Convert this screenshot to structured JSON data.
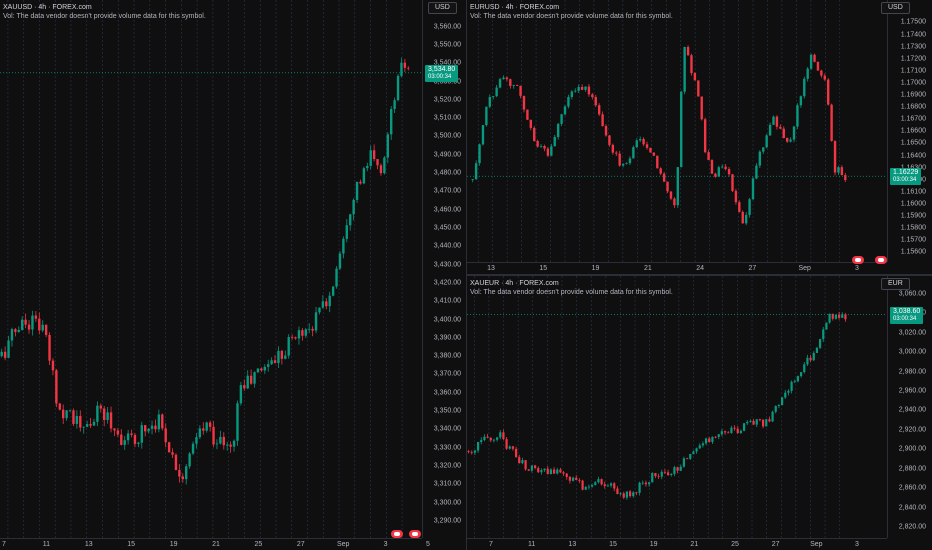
{
  "colors": {
    "up": "#089981",
    "down": "#f23645",
    "grid": "#2a2e39",
    "bg": "#0f0f0f",
    "text": "#b2b5be"
  },
  "panes": [
    {
      "id": "xauusd",
      "legend_symbol": "XAUUSD · 4h · FOREX.com",
      "legend_volume": "Vol: The data vendor doesn't provide volume data for this symbol.",
      "currency": "USD",
      "price_label": "3,534.80",
      "countdown": "03:00:34",
      "y_ticks": [
        "3,560.00",
        "3,550.00",
        "3,540.00",
        "3,530.00",
        "3,520.00",
        "3,510.00",
        "3,500.00",
        "3,490.00",
        "3,480.00",
        "3,470.00",
        "3,460.00",
        "3,450.00",
        "3,440.00",
        "3,430.00",
        "3,420.00",
        "3,410.00",
        "3,400.00",
        "3,390.00",
        "3,380.00",
        "3,370.00",
        "3,360.00",
        "3,350.00",
        "3,340.00",
        "3,330.00",
        "3,320.00",
        "3,310.00",
        "3,300.00",
        "3,290.00"
      ],
      "x_ticks": [
        "7",
        "11",
        "13",
        "15",
        "19",
        "21",
        "25",
        "27",
        "Sep",
        "3",
        "5"
      ]
    },
    {
      "id": "eurusd",
      "legend_symbol": "EURUSD · 4h · FOREX.com",
      "legend_volume": "Vol: The data vendor doesn't provide volume data for this symbol.",
      "currency": "USD",
      "price_label": "1.16229",
      "countdown": "03:00:34",
      "y_ticks": [
        "1.17500",
        "1.17400",
        "1.17300",
        "1.17200",
        "1.17100",
        "1.17000",
        "1.16900",
        "1.16800",
        "1.16700",
        "1.16600",
        "1.16500",
        "1.16400",
        "1.16300",
        "1.16200",
        "1.16100",
        "1.16000",
        "1.15900",
        "1.15800",
        "1.15700",
        "1.15600"
      ],
      "x_ticks": [
        "13",
        "15",
        "19",
        "21",
        "24",
        "27",
        "Sep",
        "3"
      ]
    },
    {
      "id": "xaueur",
      "legend_symbol": "XAUEUR · 4h · FOREX.com",
      "legend_volume": "Vol: The data vendor doesn't provide volume data for this symbol.",
      "currency": "EUR",
      "price_label": "3,038.60",
      "countdown": "03:00:34",
      "y_ticks": [
        "3,060.00",
        "3,040.00",
        "3,020.00",
        "3,000.00",
        "2,980.00",
        "2,960.00",
        "2,940.00",
        "2,920.00",
        "2,900.00",
        "2,880.00",
        "2,860.00",
        "2,840.00",
        "2,820.00"
      ],
      "x_ticks": [
        "7",
        "11",
        "13",
        "15",
        "19",
        "21",
        "25",
        "27",
        "Sep",
        "3"
      ]
    }
  ],
  "chart_data": [
    {
      "type": "candlestick",
      "symbol": "XAUUSD",
      "interval": "4h",
      "ylim": [
        3285,
        3568
      ],
      "x_ticks": [
        "7",
        "11",
        "13",
        "15",
        "19",
        "21",
        "25",
        "27",
        "Sep",
        "3",
        "5"
      ],
      "close_path": [
        [
          0,
          3380
        ],
        [
          4,
          3397
        ],
        [
          8,
          3400
        ],
        [
          10,
          3395
        ],
        [
          12,
          3375
        ],
        [
          14,
          3350
        ],
        [
          16,
          3352
        ],
        [
          18,
          3345
        ],
        [
          20,
          3338
        ],
        [
          22,
          3345
        ],
        [
          24,
          3350
        ],
        [
          26,
          3346
        ],
        [
          28,
          3338
        ],
        [
          30,
          3335
        ],
        [
          32,
          3332
        ],
        [
          34,
          3340
        ],
        [
          36,
          3342
        ],
        [
          38,
          3346
        ],
        [
          40,
          3336
        ],
        [
          42,
          3322
        ],
        [
          44,
          3316
        ],
        [
          46,
          3325
        ],
        [
          48,
          3338
        ],
        [
          50,
          3342
        ],
        [
          52,
          3335
        ],
        [
          54,
          3332
        ],
        [
          56,
          3327
        ],
        [
          58,
          3364
        ],
        [
          60,
          3366
        ],
        [
          62,
          3370
        ],
        [
          64,
          3375
        ],
        [
          66,
          3378
        ],
        [
          68,
          3382
        ],
        [
          70,
          3388
        ],
        [
          72,
          3392
        ],
        [
          74,
          3395
        ],
        [
          76,
          3398
        ],
        [
          78,
          3408
        ],
        [
          80,
          3412
        ],
        [
          82,
          3435
        ],
        [
          84,
          3455
        ],
        [
          86,
          3472
        ],
        [
          88,
          3478
        ],
        [
          90,
          3490
        ],
        [
          92,
          3478
        ],
        [
          94,
          3500
        ],
        [
          96,
          3528
        ],
        [
          98,
          3540
        ],
        [
          99,
          3536
        ]
      ],
      "last": 3534.8
    },
    {
      "type": "candlestick",
      "symbol": "EURUSD",
      "interval": "4h",
      "ylim": [
        1.1557,
        1.1757
      ],
      "x_ticks": [
        "13",
        "15",
        "19",
        "21",
        "24",
        "27",
        "Sep",
        "3"
      ],
      "close_path": [
        [
          0,
          1.162
        ],
        [
          4,
          1.1685
        ],
        [
          8,
          1.1705
        ],
        [
          12,
          1.1695
        ],
        [
          16,
          1.1655
        ],
        [
          20,
          1.164
        ],
        [
          24,
          1.168
        ],
        [
          28,
          1.17
        ],
        [
          32,
          1.169
        ],
        [
          36,
          1.165
        ],
        [
          40,
          1.163
        ],
        [
          44,
          1.1655
        ],
        [
          48,
          1.164
        ],
        [
          52,
          1.161
        ],
        [
          54,
          1.16
        ],
        [
          56,
          1.1735
        ],
        [
          58,
          1.171
        ],
        [
          60,
          1.169
        ],
        [
          62,
          1.164
        ],
        [
          64,
          1.162
        ],
        [
          66,
          1.163
        ],
        [
          68,
          1.1625
        ],
        [
          70,
          1.16
        ],
        [
          72,
          1.1585
        ],
        [
          76,
          1.164
        ],
        [
          80,
          1.167
        ],
        [
          84,
          1.165
        ],
        [
          88,
          1.17
        ],
        [
          90,
          1.1725
        ],
        [
          92,
          1.1705
        ],
        [
          94,
          1.17
        ],
        [
          96,
          1.163
        ],
        [
          98,
          1.1625
        ],
        [
          99,
          1.1623
        ]
      ],
      "last": 1.16229
    },
    {
      "type": "candlestick",
      "symbol": "XAUEUR",
      "interval": "4h",
      "ylim": [
        2815,
        3066
      ],
      "x_ticks": [
        "7",
        "11",
        "13",
        "15",
        "19",
        "21",
        "25",
        "27",
        "Sep",
        "3"
      ],
      "close_path": [
        [
          0,
          2898
        ],
        [
          4,
          2910
        ],
        [
          8,
          2915
        ],
        [
          10,
          2905
        ],
        [
          12,
          2895
        ],
        [
          14,
          2885
        ],
        [
          16,
          2880
        ],
        [
          18,
          2878
        ],
        [
          20,
          2876
        ],
        [
          22,
          2878
        ],
        [
          24,
          2874
        ],
        [
          26,
          2872
        ],
        [
          28,
          2866
        ],
        [
          30,
          2862
        ],
        [
          32,
          2860
        ],
        [
          34,
          2866
        ],
        [
          36,
          2864
        ],
        [
          38,
          2860
        ],
        [
          40,
          2856
        ],
        [
          42,
          2852
        ],
        [
          44,
          2858
        ],
        [
          46,
          2866
        ],
        [
          48,
          2872
        ],
        [
          50,
          2876
        ],
        [
          52,
          2874
        ],
        [
          54,
          2878
        ],
        [
          56,
          2884
        ],
        [
          58,
          2896
        ],
        [
          60,
          2902
        ],
        [
          62,
          2908
        ],
        [
          64,
          2912
        ],
        [
          66,
          2916
        ],
        [
          68,
          2918
        ],
        [
          70,
          2918
        ],
        [
          72,
          2922
        ],
        [
          74,
          2926
        ],
        [
          76,
          2928
        ],
        [
          78,
          2928
        ],
        [
          80,
          2936
        ],
        [
          82,
          2950
        ],
        [
          84,
          2962
        ],
        [
          86,
          2975
        ],
        [
          88,
          2985
        ],
        [
          90,
          2995
        ],
        [
          92,
          3010
        ],
        [
          94,
          3032
        ],
        [
          96,
          3040
        ],
        [
          98,
          3038
        ],
        [
          99,
          3038
        ]
      ],
      "last": 3038.6
    }
  ]
}
